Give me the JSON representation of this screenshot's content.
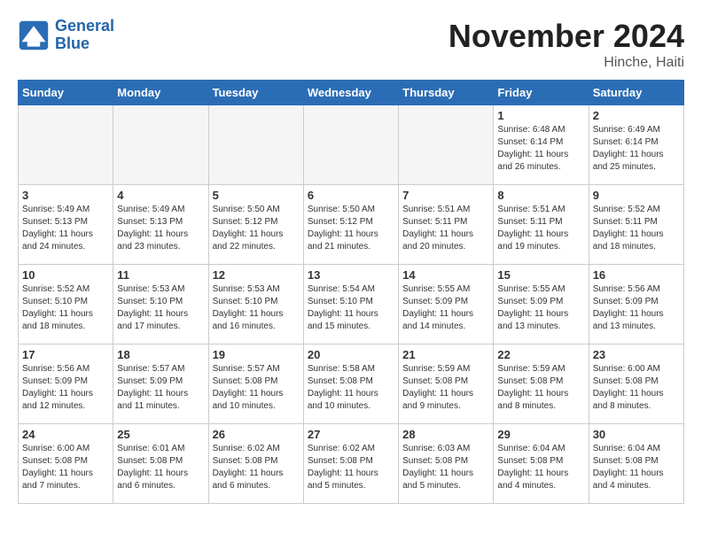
{
  "header": {
    "logo_line1": "General",
    "logo_line2": "Blue",
    "month_title": "November 2024",
    "location": "Hinche, Haiti"
  },
  "days_of_week": [
    "Sunday",
    "Monday",
    "Tuesday",
    "Wednesday",
    "Thursday",
    "Friday",
    "Saturday"
  ],
  "weeks": [
    [
      {
        "day": "",
        "content": ""
      },
      {
        "day": "",
        "content": ""
      },
      {
        "day": "",
        "content": ""
      },
      {
        "day": "",
        "content": ""
      },
      {
        "day": "",
        "content": ""
      },
      {
        "day": "1",
        "content": "Sunrise: 6:48 AM\nSunset: 6:14 PM\nDaylight: 11 hours\nand 26 minutes."
      },
      {
        "day": "2",
        "content": "Sunrise: 6:49 AM\nSunset: 6:14 PM\nDaylight: 11 hours\nand 25 minutes."
      }
    ],
    [
      {
        "day": "3",
        "content": "Sunrise: 5:49 AM\nSunset: 5:13 PM\nDaylight: 11 hours\nand 24 minutes."
      },
      {
        "day": "4",
        "content": "Sunrise: 5:49 AM\nSunset: 5:13 PM\nDaylight: 11 hours\nand 23 minutes."
      },
      {
        "day": "5",
        "content": "Sunrise: 5:50 AM\nSunset: 5:12 PM\nDaylight: 11 hours\nand 22 minutes."
      },
      {
        "day": "6",
        "content": "Sunrise: 5:50 AM\nSunset: 5:12 PM\nDaylight: 11 hours\nand 21 minutes."
      },
      {
        "day": "7",
        "content": "Sunrise: 5:51 AM\nSunset: 5:11 PM\nDaylight: 11 hours\nand 20 minutes."
      },
      {
        "day": "8",
        "content": "Sunrise: 5:51 AM\nSunset: 5:11 PM\nDaylight: 11 hours\nand 19 minutes."
      },
      {
        "day": "9",
        "content": "Sunrise: 5:52 AM\nSunset: 5:11 PM\nDaylight: 11 hours\nand 18 minutes."
      }
    ],
    [
      {
        "day": "10",
        "content": "Sunrise: 5:52 AM\nSunset: 5:10 PM\nDaylight: 11 hours\nand 18 minutes."
      },
      {
        "day": "11",
        "content": "Sunrise: 5:53 AM\nSunset: 5:10 PM\nDaylight: 11 hours\nand 17 minutes."
      },
      {
        "day": "12",
        "content": "Sunrise: 5:53 AM\nSunset: 5:10 PM\nDaylight: 11 hours\nand 16 minutes."
      },
      {
        "day": "13",
        "content": "Sunrise: 5:54 AM\nSunset: 5:10 PM\nDaylight: 11 hours\nand 15 minutes."
      },
      {
        "day": "14",
        "content": "Sunrise: 5:55 AM\nSunset: 5:09 PM\nDaylight: 11 hours\nand 14 minutes."
      },
      {
        "day": "15",
        "content": "Sunrise: 5:55 AM\nSunset: 5:09 PM\nDaylight: 11 hours\nand 13 minutes."
      },
      {
        "day": "16",
        "content": "Sunrise: 5:56 AM\nSunset: 5:09 PM\nDaylight: 11 hours\nand 13 minutes."
      }
    ],
    [
      {
        "day": "17",
        "content": "Sunrise: 5:56 AM\nSunset: 5:09 PM\nDaylight: 11 hours\nand 12 minutes."
      },
      {
        "day": "18",
        "content": "Sunrise: 5:57 AM\nSunset: 5:09 PM\nDaylight: 11 hours\nand 11 minutes."
      },
      {
        "day": "19",
        "content": "Sunrise: 5:57 AM\nSunset: 5:08 PM\nDaylight: 11 hours\nand 10 minutes."
      },
      {
        "day": "20",
        "content": "Sunrise: 5:58 AM\nSunset: 5:08 PM\nDaylight: 11 hours\nand 10 minutes."
      },
      {
        "day": "21",
        "content": "Sunrise: 5:59 AM\nSunset: 5:08 PM\nDaylight: 11 hours\nand 9 minutes."
      },
      {
        "day": "22",
        "content": "Sunrise: 5:59 AM\nSunset: 5:08 PM\nDaylight: 11 hours\nand 8 minutes."
      },
      {
        "day": "23",
        "content": "Sunrise: 6:00 AM\nSunset: 5:08 PM\nDaylight: 11 hours\nand 8 minutes."
      }
    ],
    [
      {
        "day": "24",
        "content": "Sunrise: 6:00 AM\nSunset: 5:08 PM\nDaylight: 11 hours\nand 7 minutes."
      },
      {
        "day": "25",
        "content": "Sunrise: 6:01 AM\nSunset: 5:08 PM\nDaylight: 11 hours\nand 6 minutes."
      },
      {
        "day": "26",
        "content": "Sunrise: 6:02 AM\nSunset: 5:08 PM\nDaylight: 11 hours\nand 6 minutes."
      },
      {
        "day": "27",
        "content": "Sunrise: 6:02 AM\nSunset: 5:08 PM\nDaylight: 11 hours\nand 5 minutes."
      },
      {
        "day": "28",
        "content": "Sunrise: 6:03 AM\nSunset: 5:08 PM\nDaylight: 11 hours\nand 5 minutes."
      },
      {
        "day": "29",
        "content": "Sunrise: 6:04 AM\nSunset: 5:08 PM\nDaylight: 11 hours\nand 4 minutes."
      },
      {
        "day": "30",
        "content": "Sunrise: 6:04 AM\nSunset: 5:08 PM\nDaylight: 11 hours\nand 4 minutes."
      }
    ]
  ]
}
